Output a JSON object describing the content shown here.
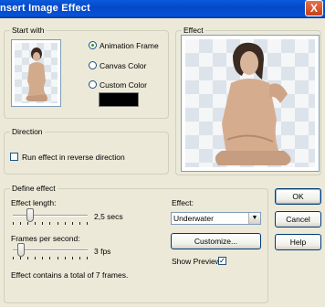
{
  "window": {
    "title": "nsert Image Effect",
    "close_glyph": "X"
  },
  "start_with": {
    "label": "Start with",
    "options": [
      "Animation Frame",
      "Canvas Color",
      "Custom Color"
    ],
    "selected": "Animation Frame",
    "custom_color": "#000000"
  },
  "effect_preview": {
    "label": "Effect"
  },
  "direction": {
    "label": "Direction",
    "reverse_label": "Run effect in reverse direction",
    "reverse_checked": false
  },
  "define_effect": {
    "label": "Define effect",
    "length_label": "Effect length:",
    "length_value": "2,5 secs",
    "length_level": 0.2,
    "fps_label": "Frames per second:",
    "fps_value": "3 fps",
    "fps_level": 0.07,
    "summary": "Effect contains a total of 7 frames.",
    "effect_label": "Effect:",
    "effect_selected": "Underwater",
    "customize_label": "Customize...",
    "show_preview_label": "Show Preview",
    "show_preview_checked": true,
    "check_glyph": "✓",
    "dropdown_glyph": "▼"
  },
  "buttons": {
    "ok": "OK",
    "cancel": "Cancel",
    "help": "Help"
  },
  "colors": {
    "title_bar": "#0a5bdc",
    "dialog_bg": "#ece9d8",
    "group_border": "#d0d0bf"
  }
}
